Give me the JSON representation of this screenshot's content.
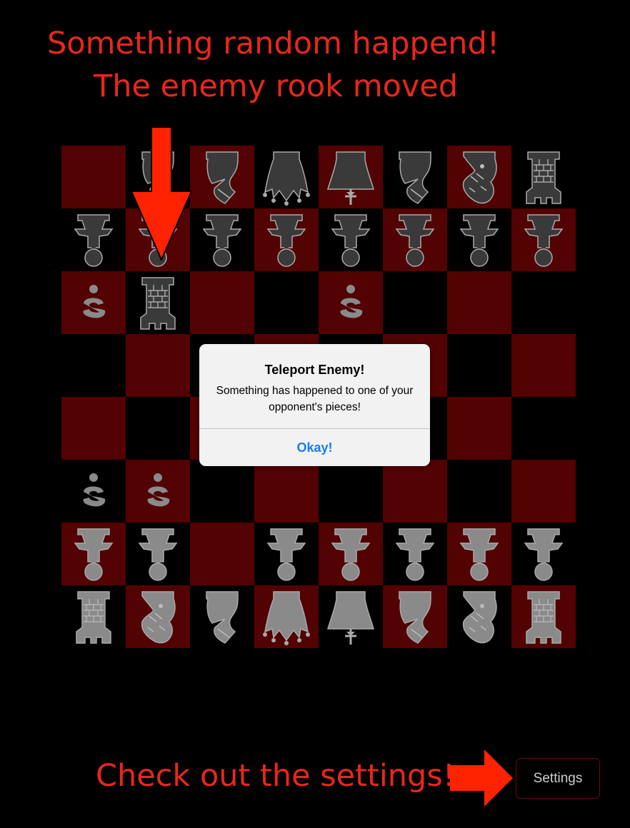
{
  "captions": {
    "top_line1": "Something random happend!",
    "top_line2": "The enemy rook moved",
    "bottom": "Check out the settings!"
  },
  "colors": {
    "dark_square": "#520202",
    "light_square": "#000000",
    "caption_red": "#e8271a",
    "arrow_red": "#ff2200",
    "enemy_piece": "#3a3a3a",
    "player_piece": "#8a8a8a",
    "dialog_link": "#1a7cf0"
  },
  "board": {
    "rows": [
      [
        {
          "piece": "",
          "side": "",
          "sq": "dark"
        },
        {
          "piece": "bishop",
          "side": "enemy",
          "sq": "light"
        },
        {
          "piece": "bishop",
          "side": "enemy",
          "sq": "dark"
        },
        {
          "piece": "queen",
          "side": "enemy",
          "sq": "light"
        },
        {
          "piece": "king",
          "side": "enemy",
          "sq": "dark"
        },
        {
          "piece": "bishop",
          "side": "enemy",
          "sq": "light"
        },
        {
          "piece": "knight",
          "side": "enemy",
          "sq": "dark"
        },
        {
          "piece": "rook",
          "side": "enemy",
          "sq": "light"
        }
      ],
      [
        {
          "piece": "pawn",
          "side": "enemy",
          "sq": "light"
        },
        {
          "piece": "pawn",
          "side": "enemy",
          "sq": "dark"
        },
        {
          "piece": "pawn",
          "side": "enemy",
          "sq": "light"
        },
        {
          "piece": "pawn",
          "side": "enemy",
          "sq": "dark"
        },
        {
          "piece": "pawn",
          "side": "enemy",
          "sq": "light"
        },
        {
          "piece": "pawn",
          "side": "enemy",
          "sq": "dark"
        },
        {
          "piece": "pawn",
          "side": "enemy",
          "sq": "light"
        },
        {
          "piece": "pawn",
          "side": "enemy",
          "sq": "dark"
        }
      ],
      [
        {
          "piece": "hint",
          "side": "player",
          "sq": "dark"
        },
        {
          "piece": "rook",
          "side": "enemy",
          "sq": "light"
        },
        {
          "piece": "",
          "side": "",
          "sq": "dark"
        },
        {
          "piece": "",
          "side": "",
          "sq": "light"
        },
        {
          "piece": "hint",
          "side": "player",
          "sq": "dark"
        },
        {
          "piece": "",
          "side": "",
          "sq": "light"
        },
        {
          "piece": "",
          "side": "",
          "sq": "dark"
        },
        {
          "piece": "",
          "side": "",
          "sq": "light"
        }
      ],
      [
        {
          "piece": "",
          "side": "",
          "sq": "light"
        },
        {
          "piece": "",
          "side": "",
          "sq": "dark"
        },
        {
          "piece": "",
          "side": "",
          "sq": "light"
        },
        {
          "piece": "",
          "side": "",
          "sq": "dark"
        },
        {
          "piece": "",
          "side": "",
          "sq": "light"
        },
        {
          "piece": "",
          "side": "",
          "sq": "dark"
        },
        {
          "piece": "",
          "side": "",
          "sq": "light"
        },
        {
          "piece": "",
          "side": "",
          "sq": "dark"
        }
      ],
      [
        {
          "piece": "",
          "side": "",
          "sq": "dark"
        },
        {
          "piece": "",
          "side": "",
          "sq": "light"
        },
        {
          "piece": "",
          "side": "",
          "sq": "dark"
        },
        {
          "piece": "",
          "side": "",
          "sq": "light"
        },
        {
          "piece": "",
          "side": "",
          "sq": "dark"
        },
        {
          "piece": "",
          "side": "",
          "sq": "light"
        },
        {
          "piece": "",
          "side": "",
          "sq": "dark"
        },
        {
          "piece": "",
          "side": "",
          "sq": "light"
        }
      ],
      [
        {
          "piece": "hint",
          "side": "player",
          "sq": "light"
        },
        {
          "piece": "hint",
          "side": "player",
          "sq": "dark"
        },
        {
          "piece": "",
          "side": "",
          "sq": "light"
        },
        {
          "piece": "",
          "side": "",
          "sq": "dark"
        },
        {
          "piece": "",
          "side": "",
          "sq": "light"
        },
        {
          "piece": "",
          "side": "",
          "sq": "dark"
        },
        {
          "piece": "",
          "side": "",
          "sq": "light"
        },
        {
          "piece": "",
          "side": "",
          "sq": "dark"
        }
      ],
      [
        {
          "piece": "pawn",
          "side": "player",
          "sq": "dark"
        },
        {
          "piece": "pawn",
          "side": "player",
          "sq": "light"
        },
        {
          "piece": "",
          "side": "",
          "sq": "dark"
        },
        {
          "piece": "pawn",
          "side": "player",
          "sq": "light"
        },
        {
          "piece": "pawn",
          "side": "player",
          "sq": "dark"
        },
        {
          "piece": "pawn",
          "side": "player",
          "sq": "light"
        },
        {
          "piece": "pawn",
          "side": "player",
          "sq": "dark"
        },
        {
          "piece": "pawn",
          "side": "player",
          "sq": "light"
        }
      ],
      [
        {
          "piece": "rook",
          "side": "player",
          "sq": "light"
        },
        {
          "piece": "knight",
          "side": "player",
          "sq": "dark"
        },
        {
          "piece": "bishop",
          "side": "player",
          "sq": "light"
        },
        {
          "piece": "queen",
          "side": "player",
          "sq": "dark"
        },
        {
          "piece": "king",
          "side": "player",
          "sq": "light"
        },
        {
          "piece": "bishop",
          "side": "player",
          "sq": "dark"
        },
        {
          "piece": "knight",
          "side": "player",
          "sq": "light"
        },
        {
          "piece": "rook",
          "side": "player",
          "sq": "dark"
        }
      ]
    ]
  },
  "dialog": {
    "title": "Teleport Enemy!",
    "message": "Something has happened to one of your opponent's pieces!",
    "button": "Okay!"
  },
  "settings": {
    "label": "Settings"
  },
  "annotations": [
    "arrow-down-icon",
    "arrow-right-icon"
  ]
}
